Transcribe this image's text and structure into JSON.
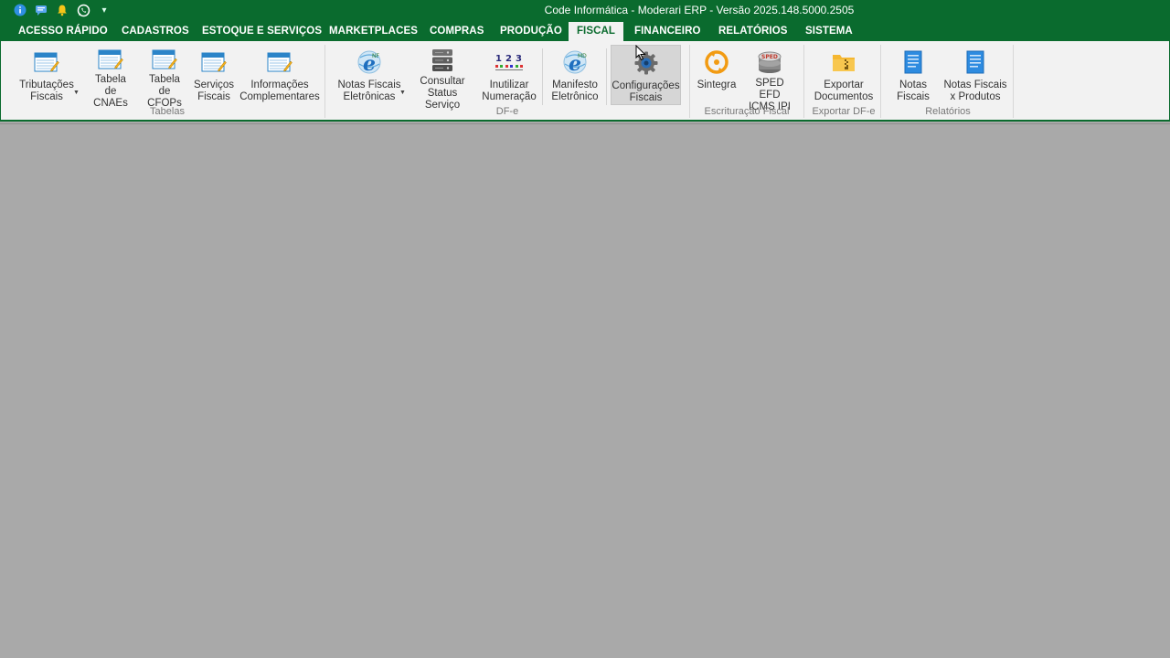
{
  "window": {
    "title": "Code Informática - Moderari ERP - Versão 2025.148.5000.2505",
    "accent_color": "#0a6b2e"
  },
  "quick_access": [
    "info-icon",
    "chat-icon",
    "bell-icon",
    "whatsapp-icon",
    "customize-icon"
  ],
  "menu_tabs": [
    {
      "label": "ACESSO RÁPIDO"
    },
    {
      "label": "CADASTROS"
    },
    {
      "label": "ESTOQUE E SERVIÇOS"
    },
    {
      "label": "MARKETPLACES"
    },
    {
      "label": "COMPRAS"
    },
    {
      "label": "PRODUÇÃO"
    },
    {
      "label": "FISCAL",
      "active": true
    },
    {
      "label": "FINANCEIRO"
    },
    {
      "label": "RELATÓRIOS"
    },
    {
      "label": "SISTEMA"
    }
  ],
  "ribbon": {
    "groups": {
      "tabelas": {
        "label": "Tabelas",
        "buttons": [
          {
            "label": "Tributações\nFiscais",
            "icon": "table-edit-icon",
            "dropdown": true
          },
          {
            "label": "Tabela\nde CNAEs",
            "icon": "table-edit-icon"
          },
          {
            "label": "Tabela\nde CFOPs",
            "icon": "table-edit-icon"
          },
          {
            "label": "Serviços\nFiscais",
            "icon": "table-edit-icon"
          },
          {
            "label": "Informações\nComplementares",
            "icon": "table-edit-icon"
          }
        ]
      },
      "dfe": {
        "label": "DF-e",
        "buttons": [
          {
            "label": "Notas Fiscais\nEletrônicas",
            "icon": "nfe-icon",
            "dropdown": true
          },
          {
            "label": "Consultar\nStatus Serviço",
            "icon": "server-icon"
          },
          {
            "label": "Inutilizar\nNumeração",
            "icon": "numbering-icon"
          },
          {
            "label": "Manifesto\nEletrônico",
            "icon": "nfe-icon"
          },
          {
            "label": "Configurações\nFiscais",
            "icon": "gear-icon",
            "hovered": true
          }
        ]
      },
      "escrituracao": {
        "label": "Escrituração Fiscal",
        "buttons": [
          {
            "label": "Sintegra",
            "icon": "sintegra-icon"
          },
          {
            "label": "SPED EFD\nICMS IPI",
            "icon": "sped-icon"
          }
        ]
      },
      "exportar": {
        "label": "Exportar DF-e",
        "buttons": [
          {
            "label": "Exportar\nDocumentos",
            "icon": "folder-zip-icon"
          }
        ]
      },
      "relatorios": {
        "label": "Relatórios",
        "buttons": [
          {
            "label": "Notas\nFiscais",
            "icon": "report-icon"
          },
          {
            "label": "Notas Fiscais\nx Produtos",
            "icon": "report-icon"
          }
        ]
      }
    }
  }
}
